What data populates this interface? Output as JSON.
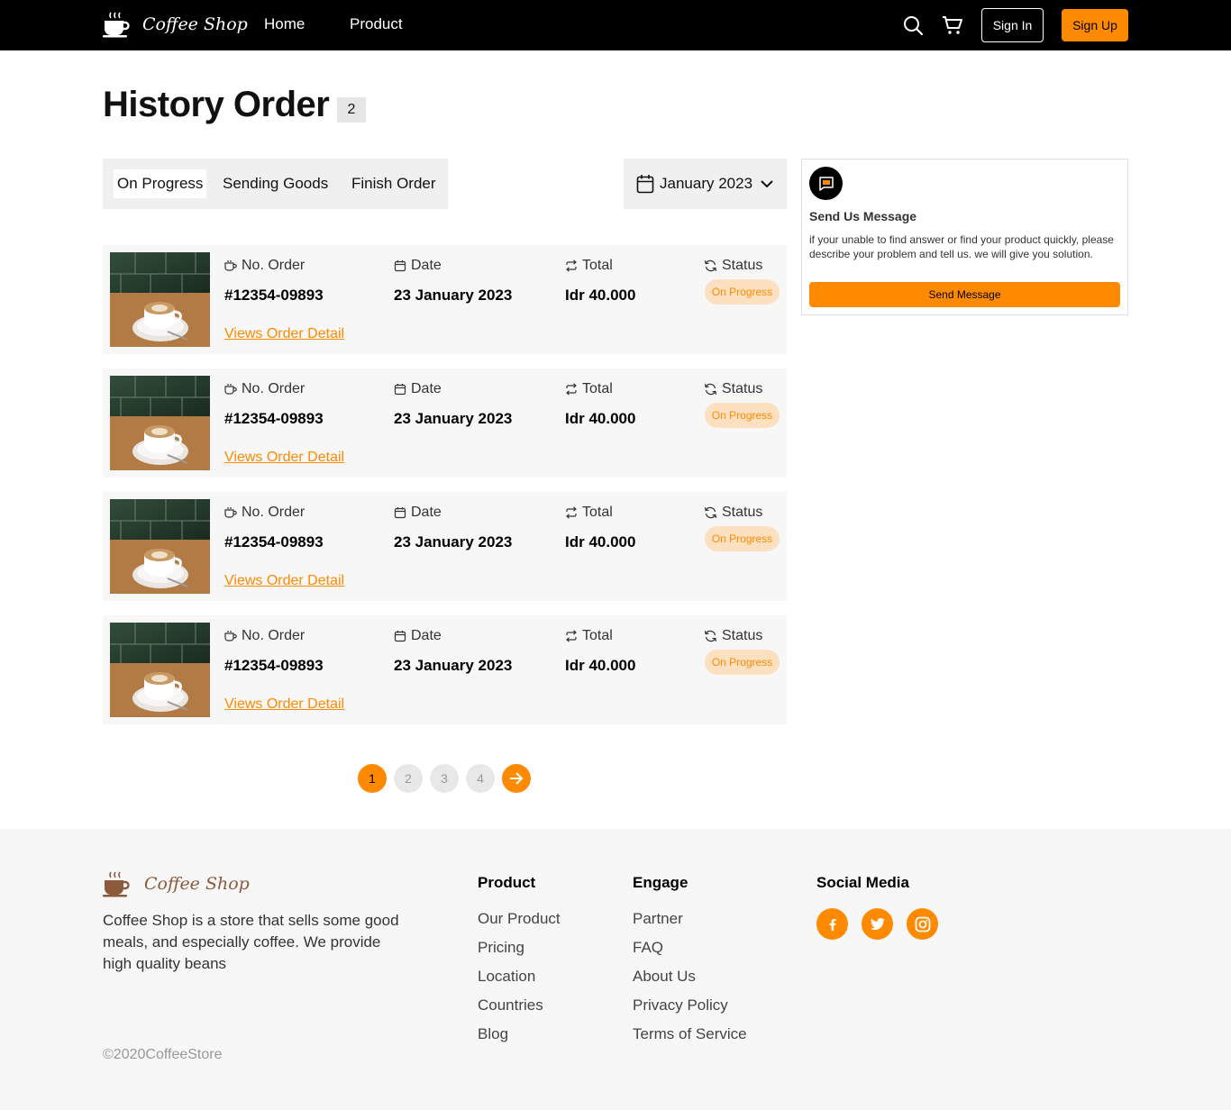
{
  "nav": {
    "brand": "Coffee Shop",
    "links": [
      "Home",
      "Product"
    ],
    "sign_in": "Sign In",
    "sign_up": "Sign Up"
  },
  "page": {
    "title": "History Order",
    "count": "2"
  },
  "tabs": [
    {
      "label": "On Progress",
      "active": true
    },
    {
      "label": "Sending Goods",
      "active": false
    },
    {
      "label": "Finish Order",
      "active": false
    }
  ],
  "filter": {
    "month": "January 2023"
  },
  "order_labels": {
    "no_order": "No. Order",
    "date": "Date",
    "total": "Total",
    "status": "Status",
    "detail_link": "Views Order Detail"
  },
  "orders": [
    {
      "number": "#12354-09893",
      "date": "23 January 2023",
      "total": "Idr 40.000",
      "status": "On Progress"
    },
    {
      "number": "#12354-09893",
      "date": "23 January 2023",
      "total": "Idr 40.000",
      "status": "On Progress"
    },
    {
      "number": "#12354-09893",
      "date": "23 January 2023",
      "total": "Idr 40.000",
      "status": "On Progress"
    },
    {
      "number": "#12354-09893",
      "date": "23 January 2023",
      "total": "Idr 40.000",
      "status": "On Progress"
    }
  ],
  "message_box": {
    "title": "Send Us Message",
    "description": "if your unable to find answer or find your product quickly, please describe your problem and tell us. we will give you solution.",
    "button": "Send Message"
  },
  "pagination": {
    "pages": [
      "1",
      "2",
      "3",
      "4"
    ],
    "current": "1"
  },
  "footer": {
    "brand": "Coffee Shop",
    "description": "Coffee Shop is a store that sells some good meals, and especially coffee. We provide high quality beans",
    "copyright": "©2020CoffeeStore",
    "product_title": "Product",
    "product_links": [
      "Our Product",
      "Pricing",
      "Location",
      "Countries",
      "Blog"
    ],
    "engage_title": "Engage",
    "engage_links": [
      "Partner",
      "FAQ",
      "About Us",
      "Privacy Policy",
      "Terms of Service"
    ],
    "social_title": "Social Media",
    "social_icons": [
      "facebook-icon",
      "twitter-icon",
      "instagram-icon"
    ]
  },
  "colors": {
    "accent": "#ff8a00",
    "nav_bg": "#000000",
    "card_bg": "#f7f7f7",
    "status_bg": "#fde0bf",
    "footer_bg": "#f7f7f7"
  }
}
